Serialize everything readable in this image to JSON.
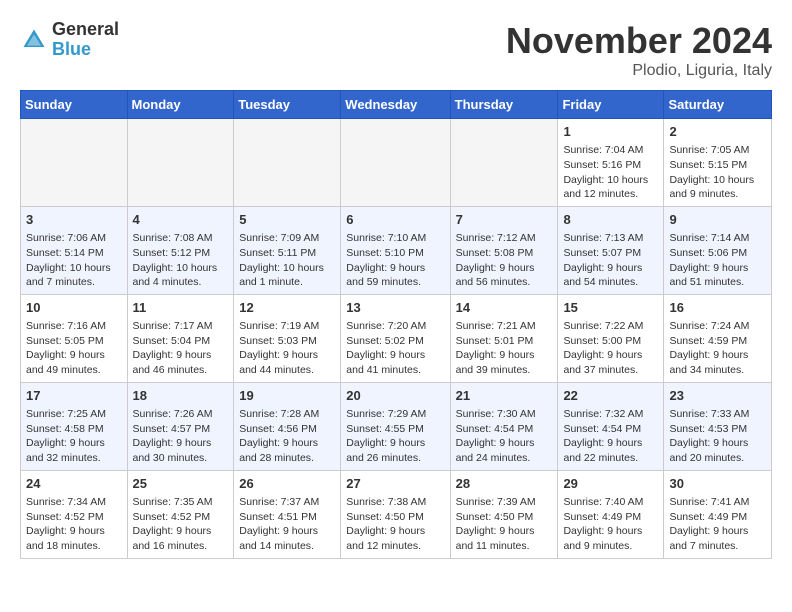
{
  "header": {
    "logo": {
      "line1": "General",
      "line2": "Blue"
    },
    "title": "November 2024",
    "location": "Plodio, Liguria, Italy"
  },
  "weekdays": [
    "Sunday",
    "Monday",
    "Tuesday",
    "Wednesday",
    "Thursday",
    "Friday",
    "Saturday"
  ],
  "weeks": [
    [
      {
        "day": "",
        "info": ""
      },
      {
        "day": "",
        "info": ""
      },
      {
        "day": "",
        "info": ""
      },
      {
        "day": "",
        "info": ""
      },
      {
        "day": "",
        "info": ""
      },
      {
        "day": "1",
        "info": "Sunrise: 7:04 AM\nSunset: 5:16 PM\nDaylight: 10 hours and 12 minutes."
      },
      {
        "day": "2",
        "info": "Sunrise: 7:05 AM\nSunset: 5:15 PM\nDaylight: 10 hours and 9 minutes."
      }
    ],
    [
      {
        "day": "3",
        "info": "Sunrise: 7:06 AM\nSunset: 5:14 PM\nDaylight: 10 hours and 7 minutes."
      },
      {
        "day": "4",
        "info": "Sunrise: 7:08 AM\nSunset: 5:12 PM\nDaylight: 10 hours and 4 minutes."
      },
      {
        "day": "5",
        "info": "Sunrise: 7:09 AM\nSunset: 5:11 PM\nDaylight: 10 hours and 1 minute."
      },
      {
        "day": "6",
        "info": "Sunrise: 7:10 AM\nSunset: 5:10 PM\nDaylight: 9 hours and 59 minutes."
      },
      {
        "day": "7",
        "info": "Sunrise: 7:12 AM\nSunset: 5:08 PM\nDaylight: 9 hours and 56 minutes."
      },
      {
        "day": "8",
        "info": "Sunrise: 7:13 AM\nSunset: 5:07 PM\nDaylight: 9 hours and 54 minutes."
      },
      {
        "day": "9",
        "info": "Sunrise: 7:14 AM\nSunset: 5:06 PM\nDaylight: 9 hours and 51 minutes."
      }
    ],
    [
      {
        "day": "10",
        "info": "Sunrise: 7:16 AM\nSunset: 5:05 PM\nDaylight: 9 hours and 49 minutes."
      },
      {
        "day": "11",
        "info": "Sunrise: 7:17 AM\nSunset: 5:04 PM\nDaylight: 9 hours and 46 minutes."
      },
      {
        "day": "12",
        "info": "Sunrise: 7:19 AM\nSunset: 5:03 PM\nDaylight: 9 hours and 44 minutes."
      },
      {
        "day": "13",
        "info": "Sunrise: 7:20 AM\nSunset: 5:02 PM\nDaylight: 9 hours and 41 minutes."
      },
      {
        "day": "14",
        "info": "Sunrise: 7:21 AM\nSunset: 5:01 PM\nDaylight: 9 hours and 39 minutes."
      },
      {
        "day": "15",
        "info": "Sunrise: 7:22 AM\nSunset: 5:00 PM\nDaylight: 9 hours and 37 minutes."
      },
      {
        "day": "16",
        "info": "Sunrise: 7:24 AM\nSunset: 4:59 PM\nDaylight: 9 hours and 34 minutes."
      }
    ],
    [
      {
        "day": "17",
        "info": "Sunrise: 7:25 AM\nSunset: 4:58 PM\nDaylight: 9 hours and 32 minutes."
      },
      {
        "day": "18",
        "info": "Sunrise: 7:26 AM\nSunset: 4:57 PM\nDaylight: 9 hours and 30 minutes."
      },
      {
        "day": "19",
        "info": "Sunrise: 7:28 AM\nSunset: 4:56 PM\nDaylight: 9 hours and 28 minutes."
      },
      {
        "day": "20",
        "info": "Sunrise: 7:29 AM\nSunset: 4:55 PM\nDaylight: 9 hours and 26 minutes."
      },
      {
        "day": "21",
        "info": "Sunrise: 7:30 AM\nSunset: 4:54 PM\nDaylight: 9 hours and 24 minutes."
      },
      {
        "day": "22",
        "info": "Sunrise: 7:32 AM\nSunset: 4:54 PM\nDaylight: 9 hours and 22 minutes."
      },
      {
        "day": "23",
        "info": "Sunrise: 7:33 AM\nSunset: 4:53 PM\nDaylight: 9 hours and 20 minutes."
      }
    ],
    [
      {
        "day": "24",
        "info": "Sunrise: 7:34 AM\nSunset: 4:52 PM\nDaylight: 9 hours and 18 minutes."
      },
      {
        "day": "25",
        "info": "Sunrise: 7:35 AM\nSunset: 4:52 PM\nDaylight: 9 hours and 16 minutes."
      },
      {
        "day": "26",
        "info": "Sunrise: 7:37 AM\nSunset: 4:51 PM\nDaylight: 9 hours and 14 minutes."
      },
      {
        "day": "27",
        "info": "Sunrise: 7:38 AM\nSunset: 4:50 PM\nDaylight: 9 hours and 12 minutes."
      },
      {
        "day": "28",
        "info": "Sunrise: 7:39 AM\nSunset: 4:50 PM\nDaylight: 9 hours and 11 minutes."
      },
      {
        "day": "29",
        "info": "Sunrise: 7:40 AM\nSunset: 4:49 PM\nDaylight: 9 hours and 9 minutes."
      },
      {
        "day": "30",
        "info": "Sunrise: 7:41 AM\nSunset: 4:49 PM\nDaylight: 9 hours and 7 minutes."
      }
    ]
  ]
}
